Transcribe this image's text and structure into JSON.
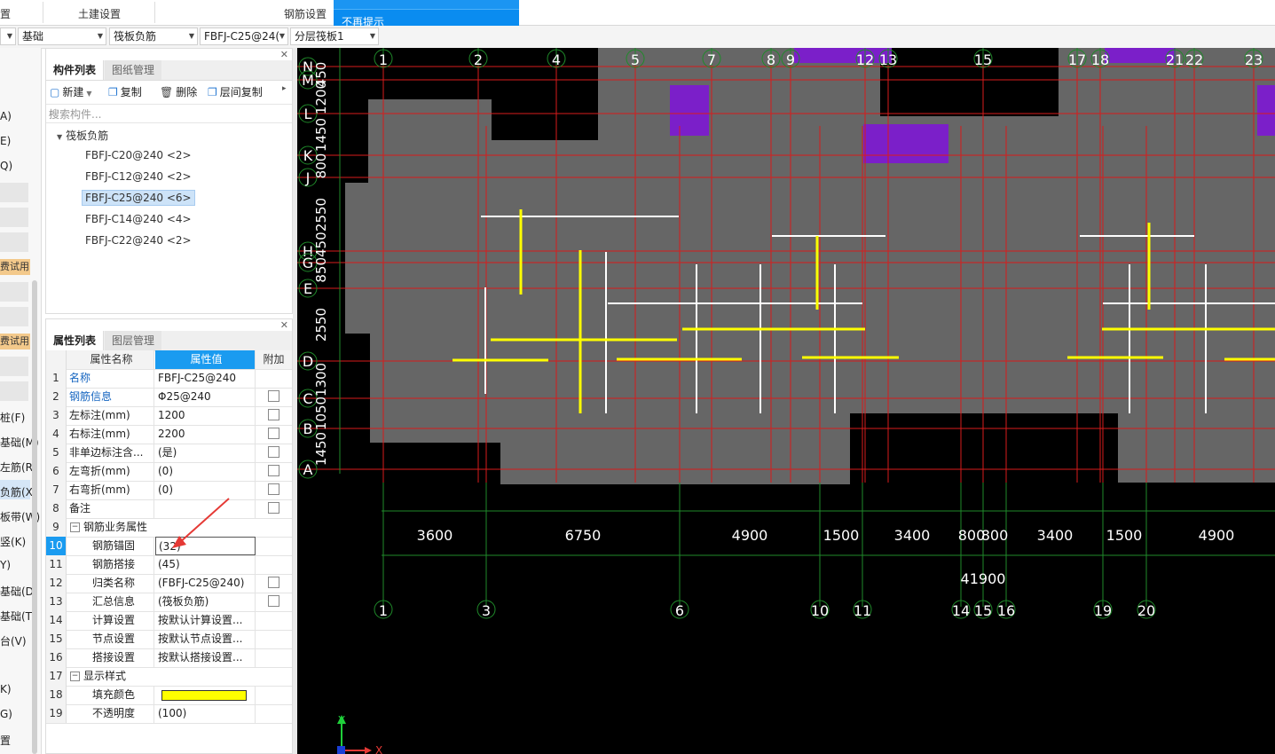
{
  "top_menu": {
    "left_fragment": "置",
    "civil_settings": "土建设置",
    "rebar_settings": "钢筋设置"
  },
  "tooltip": {
    "text": "不再提示"
  },
  "toolbar2": {
    "combos": [
      {
        "name": "floor-combo",
        "value": ""
      },
      {
        "name": "category-combo",
        "value": "基础"
      },
      {
        "name": "type-combo",
        "value": "筏板负筋"
      },
      {
        "name": "component-combo",
        "value": "FBFJ-C25@24("
      },
      {
        "name": "layer-combo",
        "value": "分层筏板1"
      }
    ]
  },
  "left_strip": {
    "items": [
      "A)",
      "E)",
      "Q)",
      "费试用",
      "费试用",
      "桩(F)",
      "基础(M)",
      "左筋(R)",
      "负筋(X)",
      "板带(W)",
      "竖(K)",
      "Y)",
      "基础(D)",
      "基础(T)",
      "台(V)",
      "K)",
      "G)",
      "置"
    ]
  },
  "component_panel": {
    "tabs": [
      "构件列表",
      "图纸管理"
    ],
    "buttons": {
      "new": "新建",
      "copy": "复制",
      "delete": "删除",
      "floor_copy": "层间复制"
    },
    "search_placeholder": "搜索构件...",
    "tree": {
      "root": "筏板负筋",
      "children": [
        "FBFJ-C20@240 <2>",
        "FBFJ-C12@240 <2>",
        "FBFJ-C25@240 <6>",
        "FBFJ-C14@240 <4>",
        "FBFJ-C22@240 <2>"
      ]
    }
  },
  "property_panel": {
    "tabs": [
      "属性列表",
      "图层管理"
    ],
    "columns": [
      "属性名称",
      "属性值",
      "附加"
    ],
    "rows": [
      {
        "num": "1",
        "name": "名称",
        "value": "FBFJ-C25@240",
        "check": false
      },
      {
        "num": "2",
        "name": "钢筋信息",
        "value": "Φ25@240",
        "check": true
      },
      {
        "num": "3",
        "name": "左标注(mm)",
        "value": "1200",
        "check": true
      },
      {
        "num": "4",
        "name": "右标注(mm)",
        "value": "2200",
        "check": true
      },
      {
        "num": "5",
        "name": "非单边标注含...",
        "value": "(是)",
        "check": true
      },
      {
        "num": "6",
        "name": "左弯折(mm)",
        "value": "(0)",
        "check": true
      },
      {
        "num": "7",
        "name": "右弯折(mm)",
        "value": "(0)",
        "check": true
      },
      {
        "num": "8",
        "name": "备注",
        "value": "",
        "check": true
      },
      {
        "num": "9",
        "name": "钢筋业务属性",
        "value": "",
        "check": false,
        "group": true
      },
      {
        "num": "10",
        "name": "钢筋锚固",
        "value": "(32)",
        "check": false,
        "selected": true
      },
      {
        "num": "11",
        "name": "钢筋搭接",
        "value": "(45)",
        "check": false
      },
      {
        "num": "12",
        "name": "归类名称",
        "value": "(FBFJ-C25@240)",
        "check": true
      },
      {
        "num": "13",
        "name": "汇总信息",
        "value": "(筏板负筋)",
        "check": true
      },
      {
        "num": "14",
        "name": "计算设置",
        "value": "按默认计算设置...",
        "check": false
      },
      {
        "num": "15",
        "name": "节点设置",
        "value": "按默认节点设置...",
        "check": false
      },
      {
        "num": "16",
        "name": "搭接设置",
        "value": "按默认搭接设置...",
        "check": false
      },
      {
        "num": "17",
        "name": "显示样式",
        "value": "",
        "check": false,
        "group": true
      },
      {
        "num": "18",
        "name": "填充颜色",
        "value": "",
        "check": false,
        "swatch": "#ffff00"
      },
      {
        "num": "19",
        "name": "不透明度",
        "value": "(100)",
        "check": false
      }
    ]
  },
  "canvas": {
    "top_axes": [
      "1",
      "2",
      "4",
      "5",
      "7",
      "8",
      "9",
      "12",
      "13",
      "15",
      "17",
      "18",
      "21",
      "22",
      "23"
    ],
    "bottom_axes": [
      "1",
      "3",
      "6",
      "10",
      "11",
      "14",
      "15",
      "16",
      "19",
      "20"
    ],
    "row_axes": [
      "N",
      "M",
      "L",
      "K",
      "J",
      "H",
      "G",
      "E",
      "D",
      "C",
      "B",
      "A"
    ],
    "left_dims": [
      "450",
      "1200",
      "1450",
      "800",
      "2550",
      "850450",
      "2550",
      "1300",
      "1050",
      "1450"
    ],
    "bottom_dims": [
      "3600",
      "6750",
      "4900",
      "1500",
      "3400",
      "800",
      "800",
      "3400",
      "1500",
      "4900"
    ],
    "total_dim": "41900",
    "coord_y": "Y",
    "coord_x": "X"
  },
  "colors": {
    "accent": "#1a9bf0",
    "canvas_bg": "#000000",
    "slab": "#666666",
    "grid_red": "#d81b1b",
    "grid_green": "#1f8a2a",
    "rebar_yellow": "#ffff00",
    "purple": "#7b1fc9"
  }
}
